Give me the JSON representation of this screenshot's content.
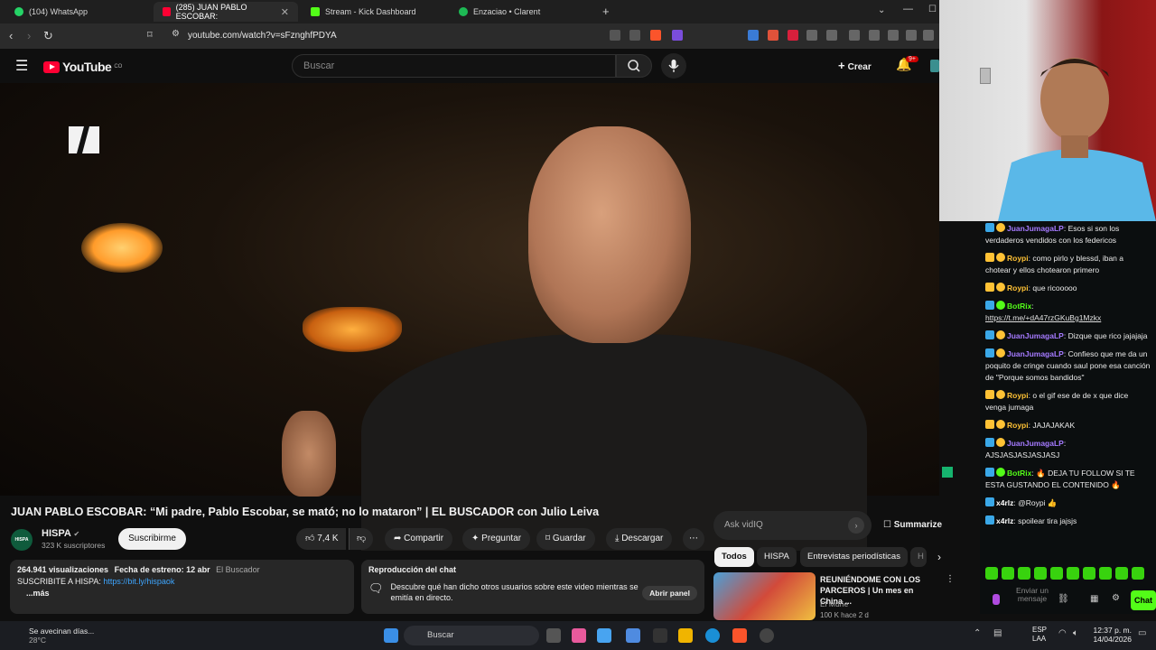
{
  "browser": {
    "tabs": [
      {
        "label": "(104) WhatsApp",
        "color": "#25d366"
      },
      {
        "label": "(285) JUAN PABLO ESCOBAR:",
        "color": "#ff0033"
      },
      {
        "label": "Stream - Kick Dashboard",
        "color": "#53fc18"
      },
      {
        "label": "Enzaciao • Clarent",
        "color": "#1db954"
      }
    ],
    "url": "youtube.com/watch?v=sFznghfPDYA"
  },
  "youtube": {
    "logo_text": "YouTube",
    "region": "CO",
    "search_placeholder": "Buscar",
    "create_label": "Crear",
    "notif_count": "9+"
  },
  "video": {
    "title": "JUAN PABLO ESCOBAR: “Mi padre, Pablo Escobar, se mató; no lo mataron” | EL BUSCADOR con Julio Leiva",
    "channel": "HISPA",
    "channel_avatar_text": "HISPA",
    "subscribers": "323 K suscriptores",
    "subscribe_label": "Suscribirme",
    "likes": "7,4 K",
    "share_label": "Compartir",
    "ask_label": "Preguntar",
    "save_label": "Guardar",
    "download_label": "Descargar"
  },
  "description": {
    "views": "264.941 visualizaciones",
    "premiere": "Fecha de estreno: 12 abr",
    "tag": "El Buscador",
    "text": "SUSCRIBITE A HISPA:",
    "link": "https://bit.ly/hispaok",
    "more": "...más"
  },
  "chat_replay": {
    "title": "Reproducción del chat",
    "text": "Descubre qué han dicho otros usuarios sobre este video mientras se emitía en directo.",
    "button": "Abrir panel"
  },
  "sidebar": {
    "ask_placeholder": "Ask vidIQ",
    "summarize_label": "Summarize",
    "chips": [
      "Todos",
      "HISPA",
      "Entrevistas periodísticas",
      "H"
    ],
    "rec_title": "REUNIÉNDOME CON LOS PARCEROS | Un mes en China ...",
    "rec_channel": "El Muñe",
    "rec_meta": "100 K   hace 2 d"
  },
  "kick_chat": {
    "messages": [
      {
        "user": "JuanJumagaLP",
        "color": "#a57aff",
        "text": "Esos si son los verdaderos vendidos con los federicos"
      },
      {
        "user": "Roypi",
        "color": "#ffc235",
        "text": "como pirlo y blessd, iban a chotear y ellos chotearon primero"
      },
      {
        "user": "Roypi",
        "color": "#ffc235",
        "text": "que ricooooo"
      },
      {
        "user": "BotRix",
        "color": "#53fc18",
        "text": "https://t.me/+dA47rzGKuBg1Mzkx"
      },
      {
        "user": "JuanJumagaLP",
        "color": "#a57aff",
        "text": "Dizque que rico jajajaja"
      },
      {
        "user": "JuanJumagaLP",
        "color": "#a57aff",
        "text": "Confieso que me da un poquito de cringe cuando saul pone esa canción de \"Porque somos bandidos\""
      },
      {
        "user": "Roypi",
        "color": "#ffc235",
        "text": "o el gif ese de de x que dice venga jumaga"
      },
      {
        "user": "Roypi",
        "color": "#ffc235",
        "text": "JAJAJAKAK"
      },
      {
        "user": "JuanJumagaLP",
        "color": "#a57aff",
        "text": "AJSJASJASJASJASJ"
      },
      {
        "user": "BotRix",
        "color": "#53fc18",
        "text": "🔥 DEJA TU FOLLOW SI TE ESTA GUSTANDO EL CONTENIDO 🔥"
      },
      {
        "user": "x4rlz",
        "color": "#ffffff",
        "text": "@Roypi 👍"
      },
      {
        "user": "x4rlz",
        "color": "#ffffff",
        "text": "spoilear tira jajsjs"
      }
    ],
    "input_placeholder": "Enviar un mensaje",
    "chat_button": "Chat"
  },
  "taskbar": {
    "weather_text": "Se avecinan días...",
    "temperature": "28°C",
    "search_label": "Buscar",
    "lang_1": "ESP",
    "lang_2": "LAA",
    "time": "12:37 p. m.",
    "date": "14/04/2026"
  }
}
